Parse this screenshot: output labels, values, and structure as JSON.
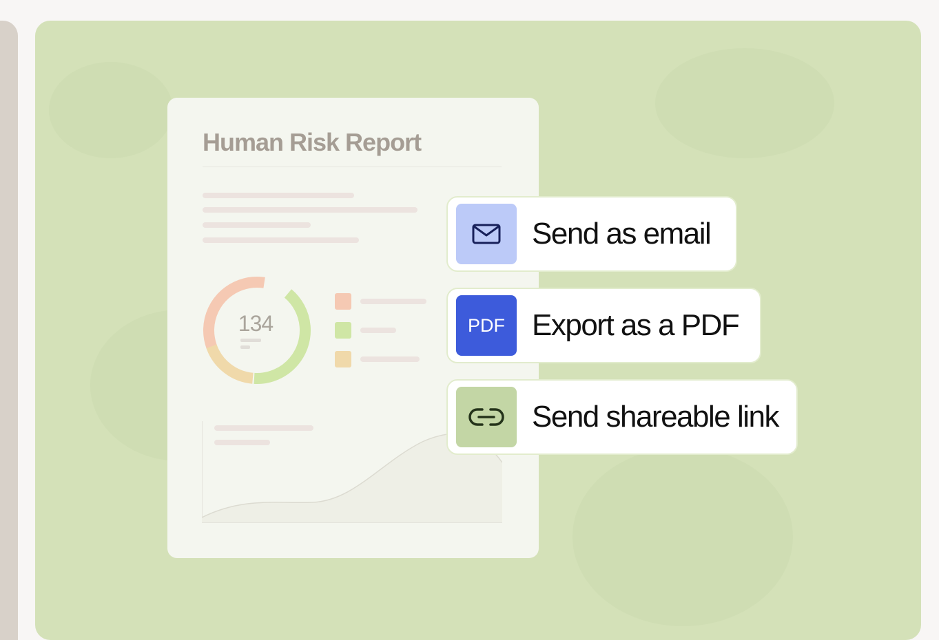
{
  "report": {
    "title": "Human Risk Report",
    "score": "134"
  },
  "actions": [
    {
      "label": "Send as email",
      "icon": "mail-icon"
    },
    {
      "label": "Export as a PDF",
      "icon": "pdf-icon",
      "icon_text": "PDF"
    },
    {
      "label": "Send shareable link",
      "icon": "link-icon"
    }
  ],
  "colors": {
    "background": "#d4e1b8",
    "email_icon_bg": "#bccaf8",
    "pdf_icon_bg": "#3d5bdb",
    "link_icon_bg": "#c3d6a5",
    "donut_orange": "#f5c9b3",
    "donut_green": "#cfe6a5",
    "donut_yellow": "#f0d9aa"
  }
}
